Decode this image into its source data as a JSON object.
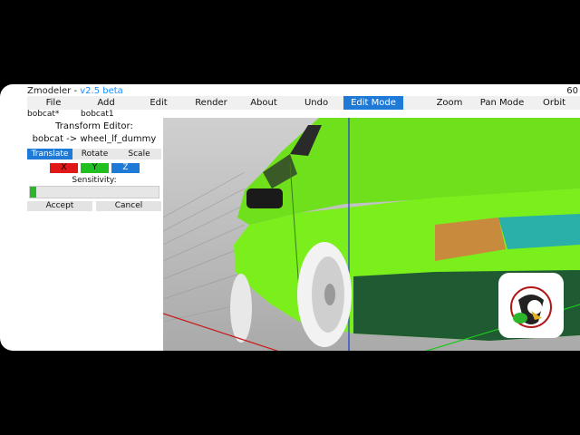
{
  "app": {
    "name": "Zmodeler",
    "version": "v2.5 beta",
    "fps": "60"
  },
  "menu": [
    "File",
    "Add",
    "Edit",
    "Render",
    "About",
    "Undo",
    "Edit Mode",
    "Zoom",
    "Pan Mode",
    "Orbit"
  ],
  "active_menu": "Edit Mode",
  "tabs": [
    "bobcat*",
    "bobcat1"
  ],
  "panel": {
    "title": "Transform Editor:",
    "target": "bobcat -> wheel_lf_dummy",
    "modes": [
      "Translate",
      "Rotate",
      "Scale"
    ],
    "active_mode": "Translate",
    "axes": [
      {
        "label": "X",
        "color": "#e01818"
      },
      {
        "label": "Y",
        "color": "#20c020"
      },
      {
        "label": "Z",
        "color": "#1e7ad6"
      }
    ],
    "sensitivity_label": "Sensitivity:",
    "sensitivity_value": 0.05,
    "accept_label": "Accept",
    "cancel_label": "Cancel"
  },
  "colors": {
    "accent": "#1e7ad6",
    "car": "#7aef1c",
    "slider": "#2db52d"
  }
}
